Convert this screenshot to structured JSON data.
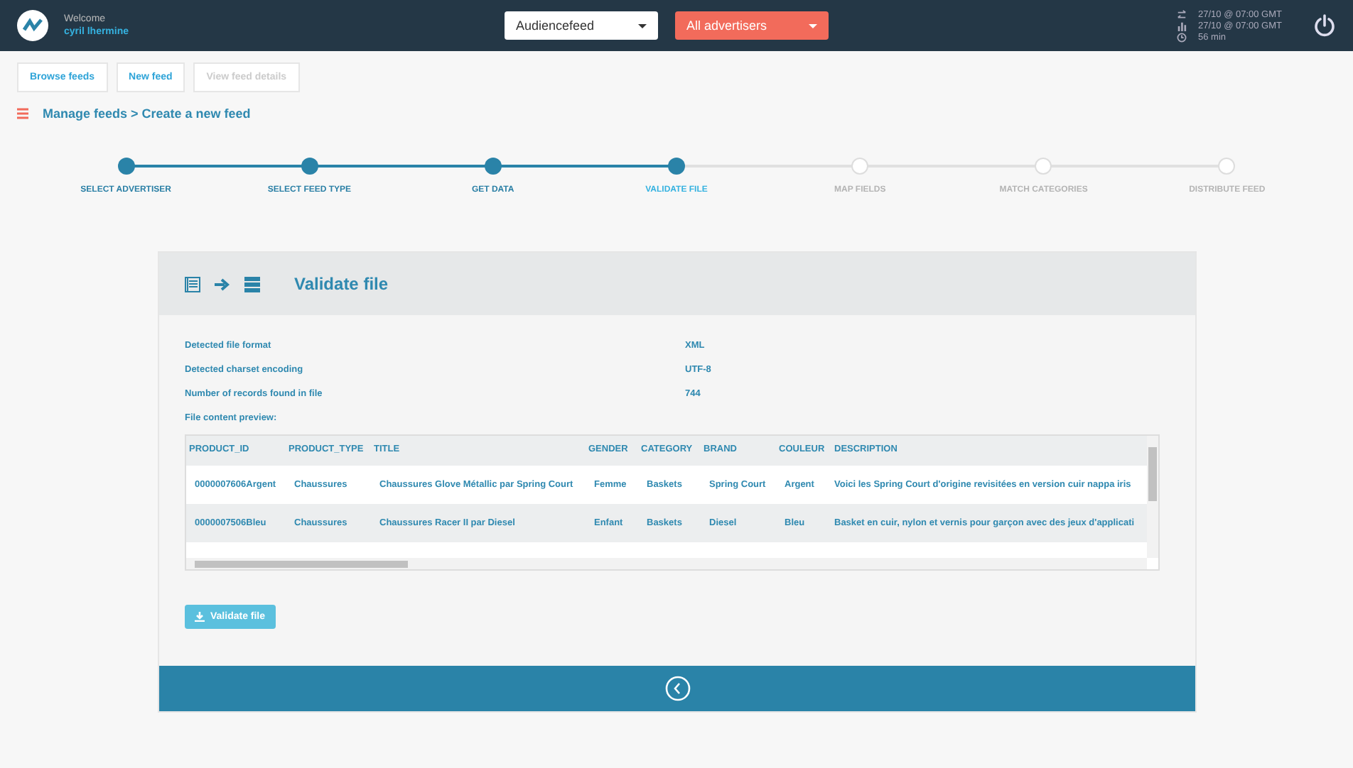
{
  "header": {
    "welcome": "Welcome",
    "user": "cyril lhermine",
    "platform_select": "Audiencefeed",
    "advertiser_select": "All advertisers",
    "stats": [
      {
        "kind": "sync",
        "text": "27/10 @ 07:00 GMT"
      },
      {
        "kind": "chart",
        "text": "27/10 @ 07:00 GMT"
      },
      {
        "kind": "clock",
        "text": "56 min"
      }
    ]
  },
  "toolbar": [
    {
      "label": "Browse feeds",
      "disabled": false
    },
    {
      "label": "New feed",
      "disabled": false
    },
    {
      "label": "View feed details",
      "disabled": true
    }
  ],
  "breadcrumb": "Manage feeds > Create a new feed",
  "steps": [
    {
      "label": "SELECT ADVERTISER",
      "completed": true,
      "selected": false
    },
    {
      "label": "SELECT FEED TYPE",
      "completed": true,
      "selected": false
    },
    {
      "label": "GET DATA",
      "completed": true,
      "selected": false
    },
    {
      "label": "VALIDATE FILE",
      "completed": true,
      "selected": true
    },
    {
      "label": "MAP FIELDS",
      "completed": false,
      "selected": false
    },
    {
      "label": "MATCH CATEGORIES",
      "completed": false,
      "selected": false
    },
    {
      "label": "DISTRIBUTE FEED",
      "completed": false,
      "selected": false
    }
  ],
  "panel": {
    "title": "Validate file",
    "info": [
      {
        "label": "Detected file format",
        "value": "XML"
      },
      {
        "label": "Detected charset encoding",
        "value": "UTF-8"
      },
      {
        "label": "Number of records found in file",
        "value": "744"
      }
    ],
    "preview_label": "File content preview:",
    "button": "Validate file"
  },
  "table": {
    "columns": [
      "PRODUCT_ID",
      "PRODUCT_TYPE",
      "TITLE",
      "GENDER",
      "CATEGORY",
      "BRAND",
      "COULEUR",
      "DESCRIPTION"
    ],
    "rows": [
      [
        "0000007606Argent",
        "Chaussures",
        "Chaussures Glove Métallic par Spring Court",
        "Femme",
        "Baskets",
        "Spring Court",
        "Argent",
        "Voici les Spring Court d'origine revisitées en version cuir nappa iris"
      ],
      [
        "0000007506Bleu",
        "Chaussures",
        "Chaussures Racer II par Diesel",
        "Enfant",
        "Baskets",
        "Diesel",
        "Bleu",
        "Basket en cuir, nylon et vernis pour garçon avec des jeux d'applicati"
      ]
    ]
  }
}
